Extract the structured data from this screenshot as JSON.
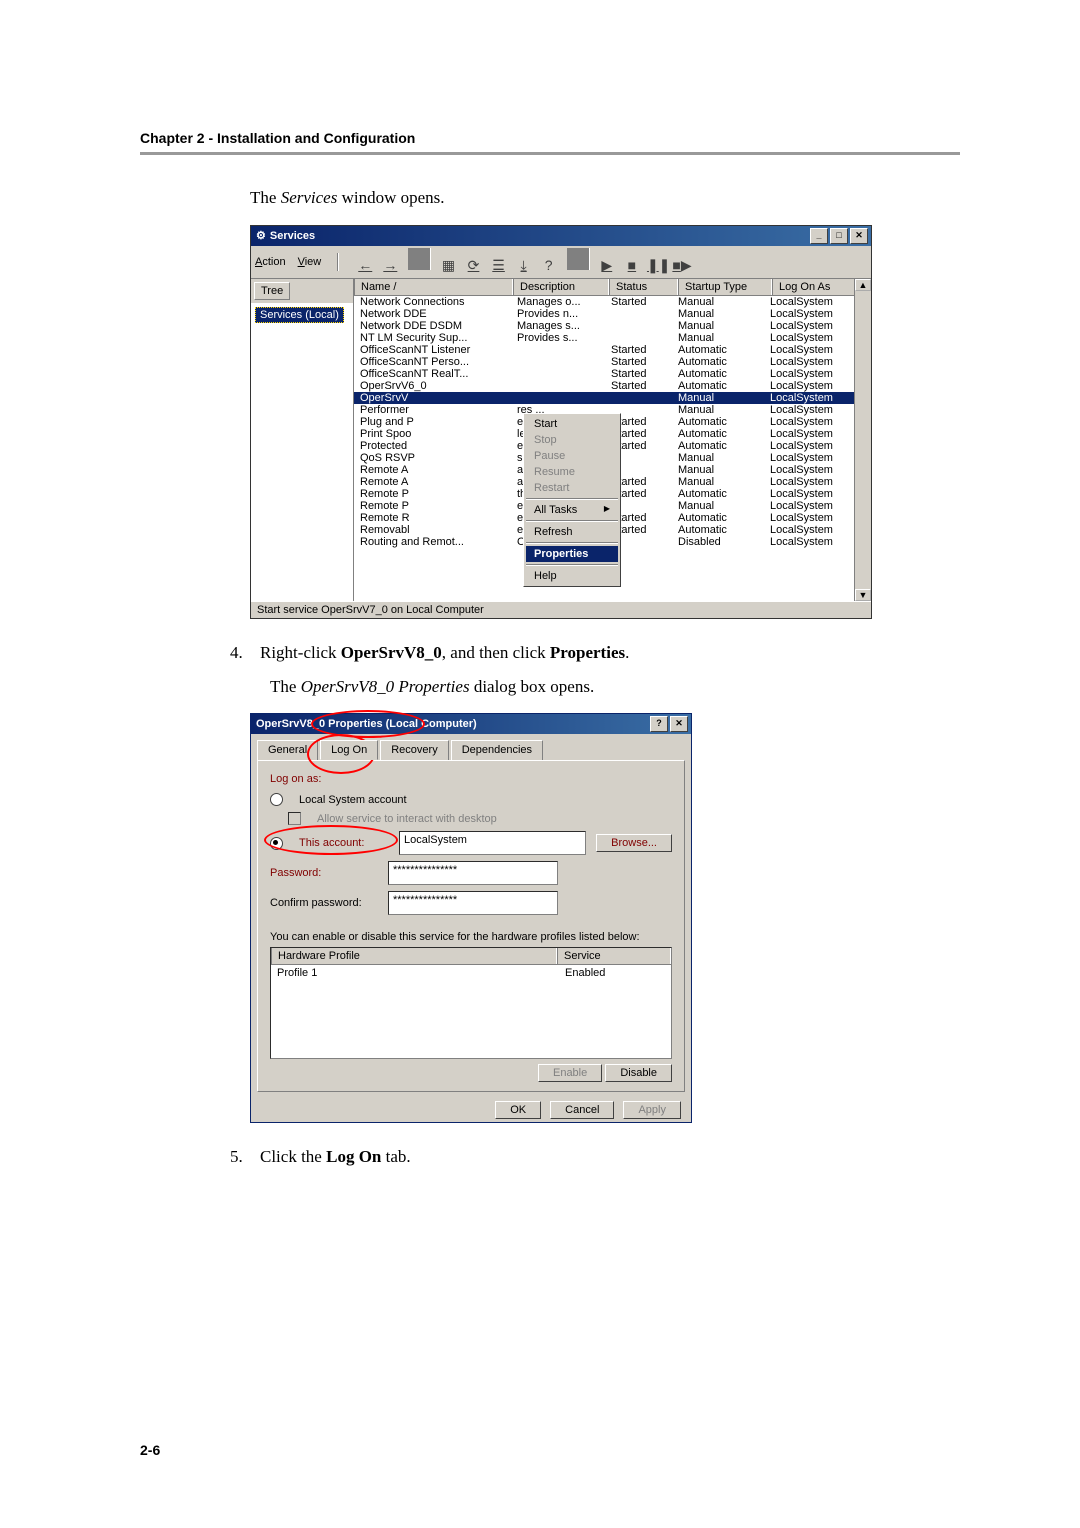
{
  "chapter_header": "Chapter 2 - Installation and Configuration",
  "intro_text_prefix": "The ",
  "intro_text_italic": "Services",
  "intro_text_suffix": " window opens.",
  "services_window": {
    "title": "Services",
    "menu": {
      "action": "Action",
      "view": "View"
    },
    "tree_tab": "Tree",
    "tree_item": "Services (Local)",
    "columns": {
      "name": "Name  /",
      "desc": "Description",
      "status": "Status",
      "startup": "Startup Type",
      "logon": "Log On As"
    },
    "rows": [
      {
        "name": "Network Connections",
        "desc": "Manages o...",
        "status": "Started",
        "startup": "Manual",
        "logon": "LocalSystem"
      },
      {
        "name": "Network DDE",
        "desc": "Provides n...",
        "status": "",
        "startup": "Manual",
        "logon": "LocalSystem"
      },
      {
        "name": "Network DDE DSDM",
        "desc": "Manages s...",
        "status": "",
        "startup": "Manual",
        "logon": "LocalSystem"
      },
      {
        "name": "NT LM Security Sup...",
        "desc": "Provides s...",
        "status": "",
        "startup": "Manual",
        "logon": "LocalSystem"
      },
      {
        "name": "OfficeScanNT Listener",
        "desc": "",
        "status": "Started",
        "startup": "Automatic",
        "logon": "LocalSystem"
      },
      {
        "name": "OfficeScanNT Perso...",
        "desc": "",
        "status": "Started",
        "startup": "Automatic",
        "logon": "LocalSystem"
      },
      {
        "name": "OfficeScanNT RealT...",
        "desc": "",
        "status": "Started",
        "startup": "Automatic",
        "logon": "LocalSystem"
      },
      {
        "name": "OperSrvV6_0",
        "desc": "",
        "status": "Started",
        "startup": "Automatic",
        "logon": "LocalSystem"
      },
      {
        "name": "OperSrvV",
        "desc": "",
        "status": "",
        "startup": "Manual",
        "logon": "LocalSystem",
        "selected": true
      },
      {
        "name": "Performer",
        "desc": "res ...",
        "status": "",
        "startup": "Manual",
        "logon": "LocalSystem"
      },
      {
        "name": "Plug and P",
        "desc": "es d...",
        "status": "Started",
        "startup": "Automatic",
        "logon": "LocalSystem"
      },
      {
        "name": "Print Spoo",
        "desc": "les ...",
        "status": "Started",
        "startup": "Automatic",
        "logon": "LocalSystem"
      },
      {
        "name": "Protected",
        "desc": "es pr...",
        "status": "Started",
        "startup": "Automatic",
        "logon": "LocalSystem"
      },
      {
        "name": "QoS RSVP",
        "desc": "s n...",
        "status": "",
        "startup": "Manual",
        "logon": "LocalSystem"
      },
      {
        "name": "Remote A",
        "desc": "a ...",
        "status": "",
        "startup": "Manual",
        "logon": "LocalSystem"
      },
      {
        "name": "Remote A",
        "desc": "a ...",
        "status": "Started",
        "startup": "Manual",
        "logon": "LocalSystem"
      },
      {
        "name": "Remote P",
        "desc": "th...",
        "status": "Started",
        "startup": "Automatic",
        "logon": "LocalSystem"
      },
      {
        "name": "Remote P",
        "desc": "es ...",
        "status": "",
        "startup": "Manual",
        "logon": "LocalSystem"
      },
      {
        "name": "Remote R",
        "desc": "e...",
        "status": "Started",
        "startup": "Automatic",
        "logon": "LocalSystem"
      },
      {
        "name": "Removabl",
        "desc": "es r...",
        "status": "Started",
        "startup": "Automatic",
        "logon": "LocalSystem"
      },
      {
        "name": "Routing and Remot...",
        "desc": "Offers rout...",
        "status": "",
        "startup": "Disabled",
        "logon": "LocalSystem"
      }
    ],
    "context_menu": {
      "start": "Start",
      "stop": "Stop",
      "pause": "Pause",
      "resume": "Resume",
      "restart": "Restart",
      "alltasks": "All Tasks",
      "refresh": "Refresh",
      "properties": "Properties",
      "help": "Help"
    },
    "statusbar": "Start service OperSrvV7_0 on Local Computer"
  },
  "step4": {
    "num": "4.",
    "text_prefix": "Right-click ",
    "bold1": "OperSrvV8_0",
    "mid": ", and then click ",
    "bold2": "Properties",
    "suffix": "."
  },
  "step4_sub_prefix": "The ",
  "step4_sub_italic": "OperSrvV8_0 Properties",
  "step4_sub_suffix": " dialog box opens.",
  "dialog": {
    "title": "OperSrvV8_0 Properties (Local Computer)",
    "tabs": {
      "general": "General",
      "logon": "Log On",
      "recovery": "Recovery",
      "deps": "Dependencies"
    },
    "logon_as": "Log on as:",
    "local_system": "Local System account",
    "allow_interact": "Allow service to interact with desktop",
    "this_account": "This account:",
    "account_value": "LocalSystem",
    "browse": "Browse...",
    "password": "Password:",
    "confirm": "Confirm password:",
    "pw_mask": "***************",
    "hw_text": "You can enable or disable this service for the hardware profiles listed below:",
    "hw_col1": "Hardware Profile",
    "hw_col2": "Service",
    "hw_profile": "Profile 1",
    "hw_state": "Enabled",
    "enable": "Enable",
    "disable": "Disable",
    "ok": "OK",
    "cancel": "Cancel",
    "apply": "Apply"
  },
  "step5": {
    "num": "5.",
    "text_prefix": "Click the ",
    "bold": "Log On",
    "suffix": " tab."
  },
  "page_number": "2-6"
}
